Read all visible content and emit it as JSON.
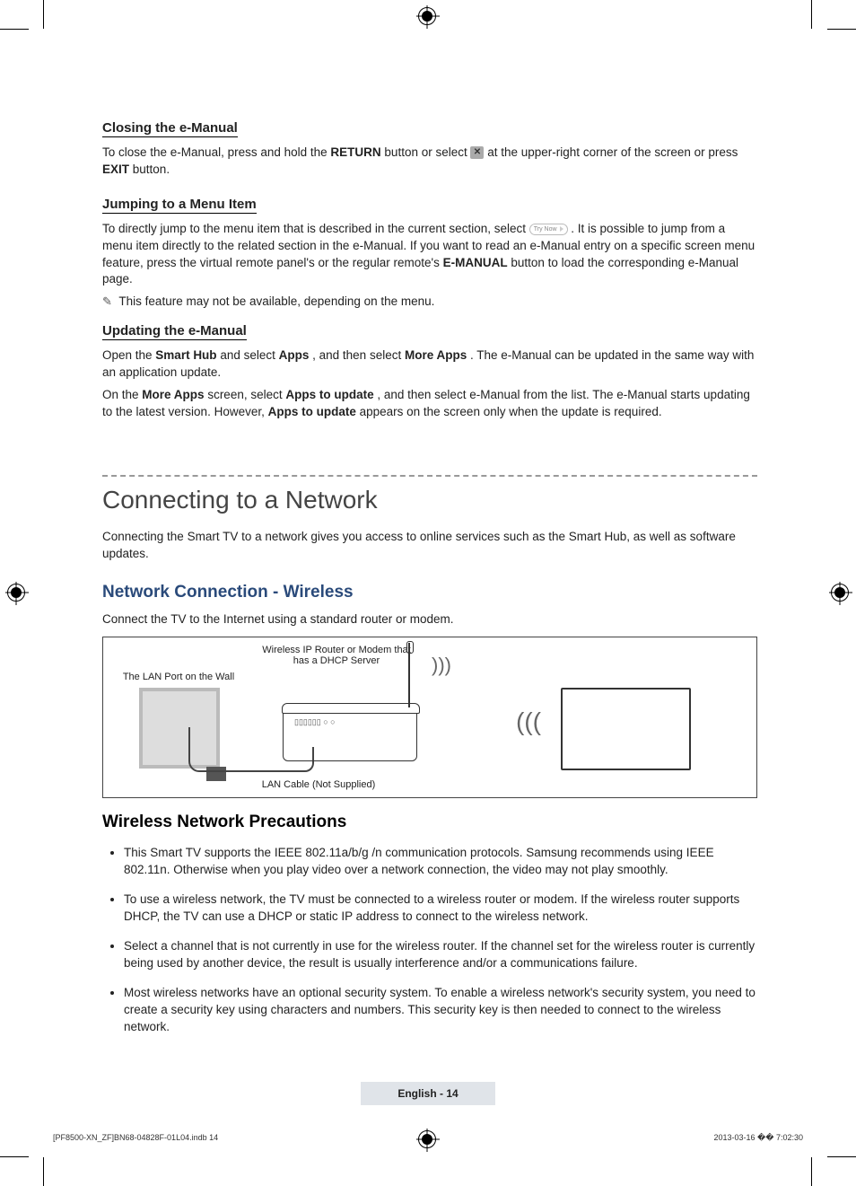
{
  "sections": {
    "closing": {
      "title": "Closing the e-Manual",
      "text_pre": "To close the e-Manual, press and hold the ",
      "return": "RETURN",
      "text_mid1": " button or select ",
      "x": "✕",
      "text_mid2": " at the upper-right corner of the screen or press ",
      "exit": "EXIT",
      "text_post": " button."
    },
    "jumping": {
      "title": "Jumping to a Menu Item",
      "text_pre": "To directly jump to the menu item that is described in the current section, select ",
      "trynow": "Try Now",
      "text_mid": ". It is possible to jump from a menu item directly to the related section in the e-Manual. If you want to read an e-Manual entry on a specific screen menu feature, press the virtual remote panel's or the regular remote's ",
      "emanual": "E-MANUAL",
      "text_post": " button to load the corresponding e-Manual page.",
      "note": "This feature may not be available, depending on the menu."
    },
    "updating": {
      "title": "Updating the e-Manual",
      "p1_pre": "Open the ",
      "smarthub": "Smart Hub",
      "p1_mid1": " and select ",
      "apps": "Apps",
      "p1_mid2": ", and then select ",
      "moreapps": "More Apps",
      "p1_post": ". The e-Manual can be updated in the same way with an application update.",
      "p2_pre": "On the ",
      "p2_moreapps": "More Apps",
      "p2_mid1": " screen, select ",
      "apps_to_update": "Apps to update",
      "p2_mid2": ", and then select e-Manual from the list. The e-Manual starts updating to the latest version. However, ",
      "p2_post": " appears on the screen only when the update is required."
    }
  },
  "network": {
    "h1": "Connecting to a Network",
    "intro": "Connecting the Smart TV to a network gives you access to online services such as the Smart Hub, as well as software updates.",
    "h2a": "Network Connection - Wireless",
    "h2a_para": "Connect the TV to the Internet using a standard router or modem.",
    "diagram": {
      "lan_wall": "The LAN Port on the Wall",
      "router": "Wireless IP Router or Modem that has a DHCP Server",
      "cable": "LAN Cable (Not Supplied)"
    },
    "h2b": "Wireless Network Precautions",
    "bullets": [
      "This Smart TV supports the IEEE 802.11a/b/g /n communication protocols. Samsung recommends using IEEE 802.11n. Otherwise when you play video over a network connection, the video may not play smoothly.",
      "To use a wireless network, the TV must be connected to a wireless router or modem. If the wireless router supports DHCP, the TV can use a DHCP or static IP address to connect to the wireless network.",
      "Select a channel that is not currently in use for the wireless router. If the channel set for the wireless router is currently being used by another device, the result is usually interference and/or a communications failure.",
      "Most wireless networks have an optional security system. To enable a wireless network's security system, you need to create a security key using characters and numbers. This security key is then needed to connect to the wireless network."
    ]
  },
  "footer": {
    "pagelabel": "English - 14",
    "filepath": "[PF8500-XN_ZF]BN68-04828F-01L04.indb   14",
    "timestamp": "2013-03-16   �� 7:02:30"
  }
}
